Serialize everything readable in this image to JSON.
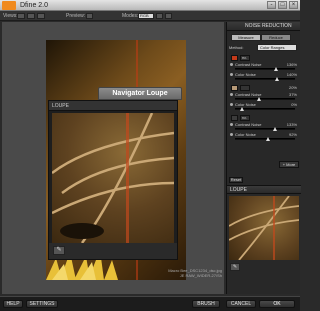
{
  "app": {
    "title": "Dfine 2.0"
  },
  "window_buttons": [
    "-",
    "□",
    "×"
  ],
  "toolbar": {
    "views_label": "Views:",
    "preview_label": "Preview:",
    "modes_label": "Modes:",
    "modes_value": "RGB"
  },
  "preview": {
    "navigator_title": "Navigator Loupe",
    "loupe_title": "LOUPE",
    "file_caption_1": "Macro Bee_DSC1234_dsc.jpg",
    "file_caption_2": "JE RAW_WIDER-27/Sh"
  },
  "panel": {
    "title": "NOISE REDUCTION",
    "tabs": [
      "Measure",
      "Reduce"
    ],
    "method_label": "Method:",
    "method_value": "Color Ranges",
    "groups": [
      {
        "swatch_color": "#c43a1a",
        "swatch_label": "8%",
        "side_pct": "",
        "sliders": [
          {
            "label": "Contrast Noise",
            "value": "136%",
            "pos": 0.68
          },
          {
            "label": "Color Noise",
            "value": "140%",
            "pos": 0.7
          }
        ]
      },
      {
        "swatch_color": "#b79a78",
        "swatch_label": "",
        "side_pct": "20%",
        "sliders": [
          {
            "label": "Contrast Noise",
            "value": "37%",
            "pos": 0.4
          },
          {
            "label": "Color Noise",
            "value": "0%",
            "pos": 0.12
          }
        ]
      },
      {
        "swatch_color": "#3b3b3b",
        "swatch_label": "6%",
        "side_pct": "",
        "sliders": [
          {
            "label": "Contrast Noise",
            "value": "133%",
            "pos": 0.66
          },
          {
            "label": "Color Noise",
            "value": "92%",
            "pos": 0.55
          }
        ]
      }
    ],
    "more_label": "+ More",
    "reset_label": "Reset",
    "loupe_title": "LOUPE"
  },
  "bottombar": {
    "help": "HELP",
    "settings": "SETTINGS",
    "brush": "BRUSH",
    "cancel": "CANCEL",
    "ok": "OK"
  }
}
